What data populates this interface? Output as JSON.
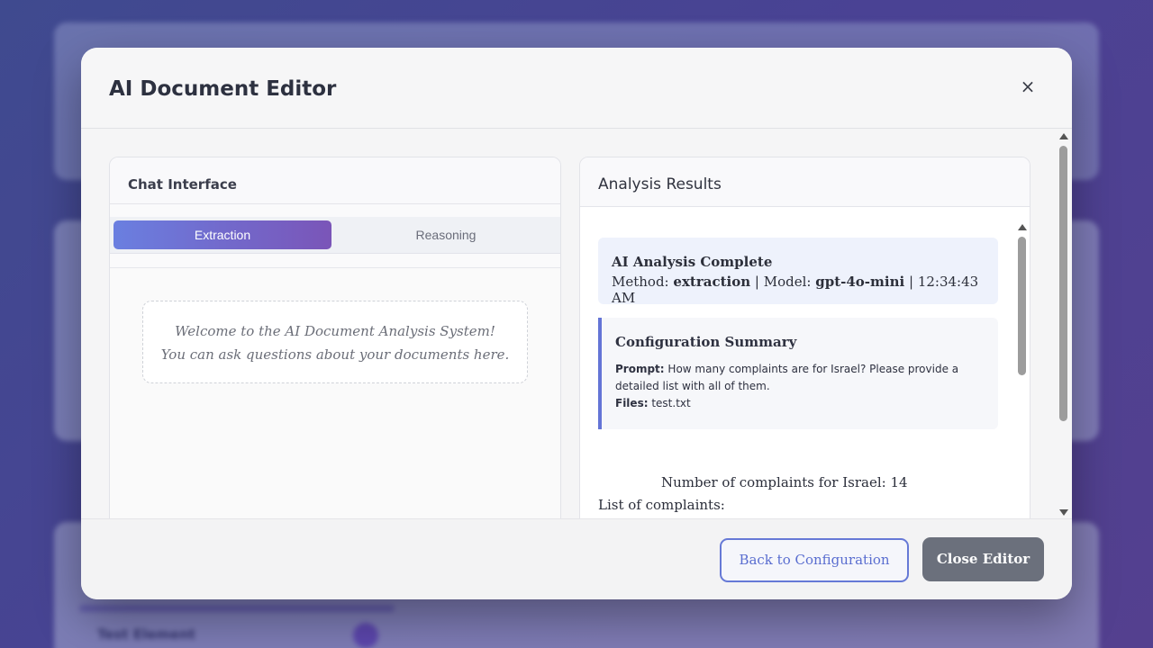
{
  "background": {
    "text": "Test Element"
  },
  "modal": {
    "title": "AI Document Editor",
    "close_symbol": "×"
  },
  "chat": {
    "header": "Chat Interface",
    "tabs": [
      {
        "label": "Extraction",
        "active": true
      },
      {
        "label": "Reasoning",
        "active": false
      }
    ],
    "welcome_line1": "Welcome to the AI Document Analysis System!",
    "welcome_line2": "You can ask questions about your documents here."
  },
  "results": {
    "header": "Analysis Results",
    "complete": {
      "title": "AI Analysis Complete",
      "method_label": "Method:",
      "method_value": "extraction",
      "model_label": "| Model:",
      "model_value": "gpt-4o-mini",
      "time": "| 12:34:43 AM"
    },
    "config": {
      "title": "Configuration Summary",
      "prompt_label": "Prompt:",
      "prompt_value": "How many complaints are for Israel? Please provide a detailed list with all of them.",
      "files_label": "Files:",
      "files_value": "test.txt"
    },
    "output_line1": "Number of complaints for Israel: 14",
    "output_line2": "List of complaints:"
  },
  "footer": {
    "back_label": "Back to Configuration",
    "close_label": "Close Editor"
  },
  "colors": {
    "accent": "#6679d6",
    "tab_gradient_start": "#6a7fe0",
    "tab_gradient_end": "#7a55b8",
    "close_button": "#6b707c"
  }
}
